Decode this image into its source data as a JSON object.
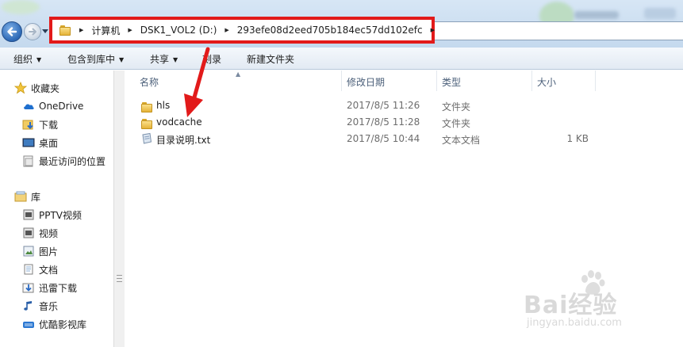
{
  "address_bar": {
    "crumbs": [
      "计算机",
      "DSK1_VOL2 (D:)",
      "293efe08d2eed705b184ec57dd102efc"
    ]
  },
  "toolbar": {
    "organize": "组织",
    "include_in_library": "包含到库中",
    "share": "共享",
    "burn": "刻录",
    "new_folder": "新建文件夹"
  },
  "nav_pane": {
    "favorites": "收藏夹",
    "favorites_items": [
      "OneDrive",
      "下载",
      "桌面",
      "最近访问的位置"
    ],
    "libraries": "库",
    "library_items": [
      "PPTV视频",
      "视频",
      "图片",
      "文档",
      "迅雷下载",
      "音乐",
      "优酷影视库"
    ]
  },
  "file_list": {
    "columns": [
      "名称",
      "修改日期",
      "类型",
      "大小"
    ],
    "rows": [
      {
        "name": "hls",
        "date": "2017/8/5 11:26",
        "type": "文件夹",
        "size": "",
        "icon": "folder-icon"
      },
      {
        "name": "vodcache",
        "date": "2017/8/5 11:28",
        "type": "文件夹",
        "size": "",
        "icon": "folder-icon"
      },
      {
        "name": "目录说明.txt",
        "date": "2017/8/5 10:44",
        "type": "文本文档",
        "size": "1 KB",
        "icon": "text-file-icon"
      }
    ]
  },
  "watermark": {
    "logo": "Bai经验",
    "url": "jingyan.baidu.com"
  },
  "colors": {
    "highlight_box": "#e21a1a",
    "folder": "#e5b43a"
  }
}
